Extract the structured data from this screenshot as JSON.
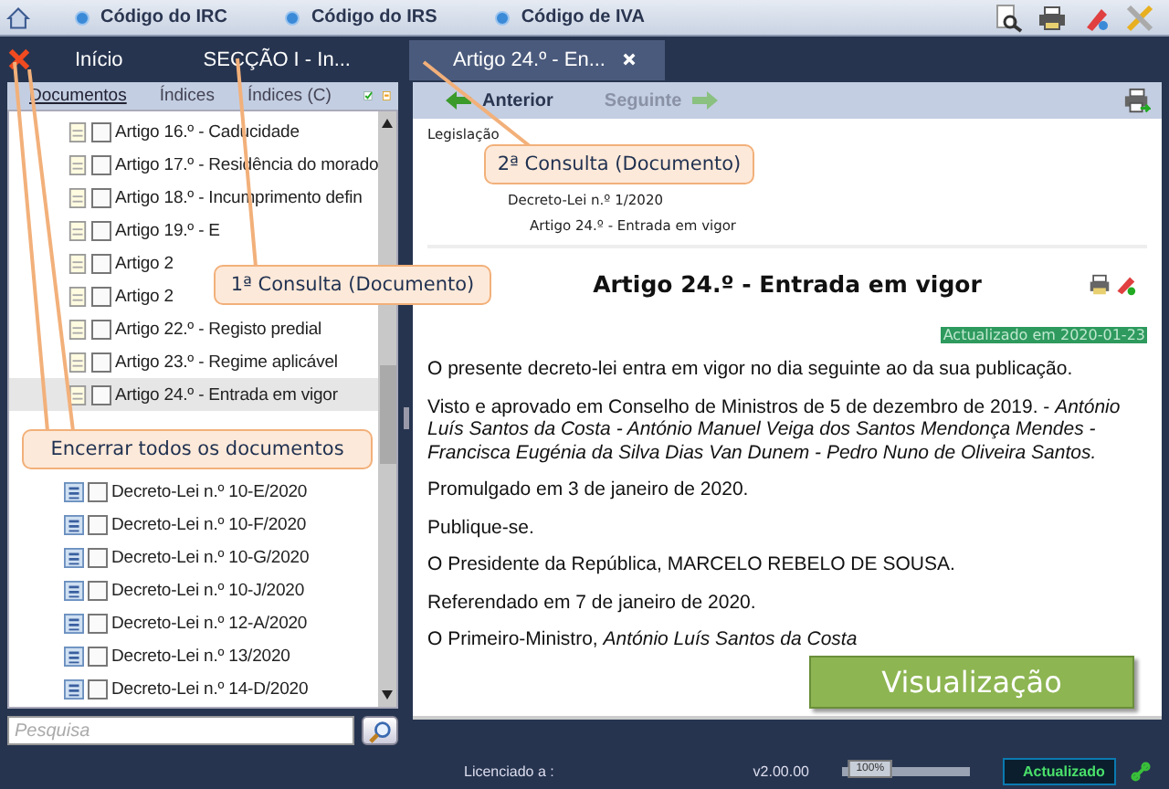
{
  "top_links": [
    {
      "label": "Código do IRC"
    },
    {
      "label": "Código do IRS"
    },
    {
      "label": "Código de IVA"
    }
  ],
  "tabs": [
    {
      "label": "Início",
      "selected": false,
      "closable": false
    },
    {
      "label": "SECÇÃO I - In...",
      "selected": false,
      "closable": false
    },
    {
      "label": "Artigo 24.º - En...",
      "selected": true,
      "closable": true
    }
  ],
  "left_tabs": [
    {
      "label": "Documentos",
      "selected": true
    },
    {
      "label": "Índices",
      "selected": false
    },
    {
      "label": "Índices (C)",
      "selected": false
    }
  ],
  "tree": [
    {
      "kind": "article",
      "label": "Artigo 16.º - Caducidade",
      "checked": false,
      "selected": false
    },
    {
      "kind": "article",
      "label": "Artigo 17.º - Residência do morado",
      "checked": false,
      "selected": false
    },
    {
      "kind": "article",
      "label": "Artigo 18.º - Incumprimento defin",
      "checked": false,
      "selected": false
    },
    {
      "kind": "article",
      "label": "Artigo 19.º - E",
      "checked": false,
      "selected": false
    },
    {
      "kind": "article",
      "label": "Artigo 2",
      "checked": false,
      "selected": false
    },
    {
      "kind": "article",
      "label": "Artigo 2",
      "checked": false,
      "selected": false
    },
    {
      "kind": "article",
      "label": "Artigo 22.º - Registo predial",
      "checked": false,
      "selected": false
    },
    {
      "kind": "article",
      "label": "Artigo 23.º - Regime aplicável",
      "checked": false,
      "selected": false
    },
    {
      "kind": "article",
      "label": "Artigo 24.º - Entrada em vigor",
      "checked": false,
      "selected": true
    },
    {
      "kind": "covered"
    },
    {
      "kind": "covered"
    },
    {
      "kind": "decree",
      "label": "Decreto-Lei n.º 10-E/2020",
      "checked": false,
      "selected": false
    },
    {
      "kind": "decree",
      "label": "Decreto-Lei n.º 10-F/2020",
      "checked": false,
      "selected": false
    },
    {
      "kind": "decree",
      "label": "Decreto-Lei n.º 10-G/2020",
      "checked": false,
      "selected": false
    },
    {
      "kind": "decree",
      "label": "Decreto-Lei n.º 10-J/2020",
      "checked": false,
      "selected": false
    },
    {
      "kind": "decree",
      "label": "Decreto-Lei n.º 12-A/2020",
      "checked": false,
      "selected": false
    },
    {
      "kind": "decree",
      "label": "Decreto-Lei n.º 13/2020",
      "checked": false,
      "selected": false
    },
    {
      "kind": "decree",
      "label": "Decreto-Lei n.º 14-D/2020",
      "checked": false,
      "selected": false
    }
  ],
  "search": {
    "placeholder": "Pesquisa"
  },
  "nav": {
    "previous": "Anterior",
    "next": "Seguinte"
  },
  "breadcrumbs": [
    "Legislação",
    "Decreto-Lei n.º 1/2020",
    "Artigo 24.º - Entrada em vigor"
  ],
  "document": {
    "title": "Artigo 24.º - Entrada em vigor",
    "updated": "Actualizado em 2020-01-23",
    "paragraphs": [
      "O presente decreto-lei entra em vigor no dia seguinte ao da sua publicação.",
      "Visto e aprovado em Conselho de Ministros de 5 de dezembro de 2019. - *António Luís Santos da Costa - António Manuel Veiga dos Santos Mendonça Mendes - Francisca Eugénia da Silva Dias Van Dunem - Pedro Nuno de Oliveira Santos.*",
      "Promulgado em 3 de janeiro de 2020.",
      "Publique-se.",
      "O Presidente da República, MARCELO REBELO DE SOUSA.",
      "Referendado em 7 de janeiro de 2020.",
      "O Primeiro-Ministro, *António Luís Santos da Costa*"
    ]
  },
  "status_bar": {
    "license": "Licenciado a :",
    "version": "v2.00.00",
    "zoom": {
      "label": "100%",
      "level": 0.22
    },
    "update_status": "Actualizado"
  },
  "callouts": [
    {
      "kind": "note",
      "text": "2ª Consulta (Documento)"
    },
    {
      "kind": "note",
      "text": "1ª Consulta (Documento)"
    },
    {
      "kind": "note",
      "text": "Encerrar todos os documentos"
    },
    {
      "kind": "banner",
      "text": "Visualização"
    }
  ]
}
